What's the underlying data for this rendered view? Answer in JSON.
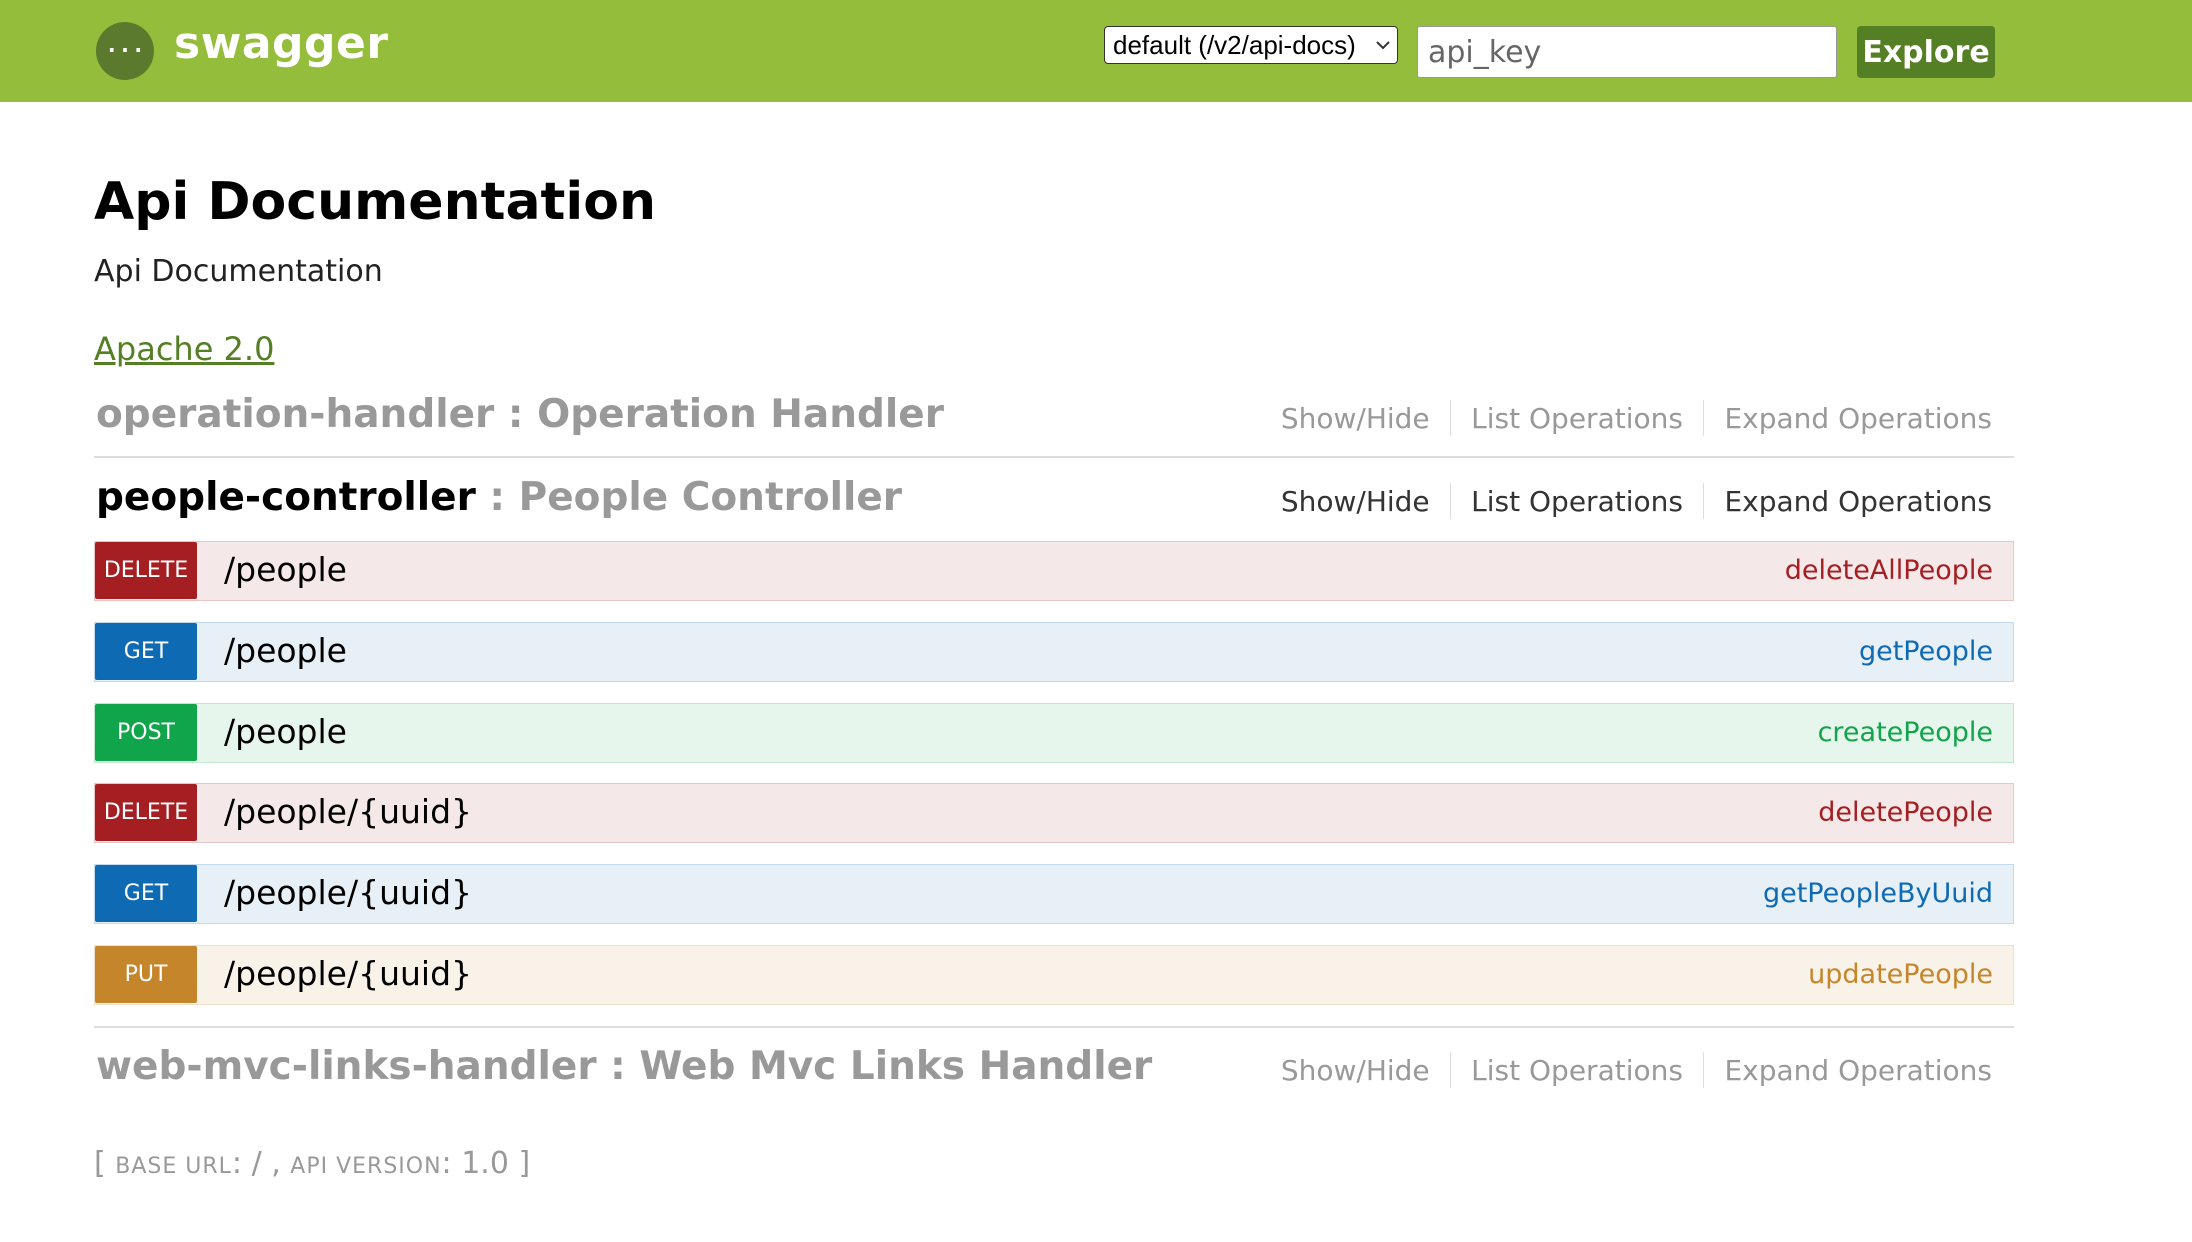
{
  "header": {
    "logo_text": "swagger",
    "spec_select_value": "default (/v2/api-docs)",
    "api_key_placeholder": "api_key",
    "explore_label": "Explore",
    "brand_color": "#93bd3a"
  },
  "info": {
    "title": "Api Documentation",
    "description": "Api Documentation",
    "license_label": "Apache 2.0"
  },
  "resources": [
    {
      "name": "operation-handler",
      "separator": " : ",
      "description": "Operation Handler",
      "show_hide": "Show/Hide",
      "list_ops": "List Operations",
      "expand_ops": "Expand Operations"
    },
    {
      "name": "people-controller",
      "separator": " : ",
      "description": "People Controller",
      "show_hide": "Show/Hide",
      "list_ops": "List Operations",
      "expand_ops": "Expand Operations",
      "operations": [
        {
          "method": "DELETE",
          "path": "/people",
          "nickname": "deleteAllPeople"
        },
        {
          "method": "GET",
          "path": "/people",
          "nickname": "getPeople"
        },
        {
          "method": "POST",
          "path": "/people",
          "nickname": "createPeople"
        },
        {
          "method": "DELETE",
          "path": "/people/{uuid}",
          "nickname": "deletePeople"
        },
        {
          "method": "GET",
          "path": "/people/{uuid}",
          "nickname": "getPeopleByUuid"
        },
        {
          "method": "PUT",
          "path": "/people/{uuid}",
          "nickname": "updatePeople"
        }
      ]
    },
    {
      "name": "web-mvc-links-handler",
      "separator": " : ",
      "description": "Web Mvc Links Handler",
      "show_hide": "Show/Hide",
      "list_ops": "List Operations",
      "expand_ops": "Expand Operations"
    }
  ],
  "footer": {
    "open": "[ ",
    "base_url_label": "BASE URL",
    "colon1": ": ",
    "base_url": "/",
    "comma": " , ",
    "api_version_label": "API VERSION",
    "colon2": ": ",
    "api_version": "1.0",
    "close": " ]"
  },
  "method_colors": {
    "DELETE": "#a41e22",
    "GET": "#0f6ab4",
    "POST": "#10a54a",
    "PUT": "#c5862b"
  }
}
